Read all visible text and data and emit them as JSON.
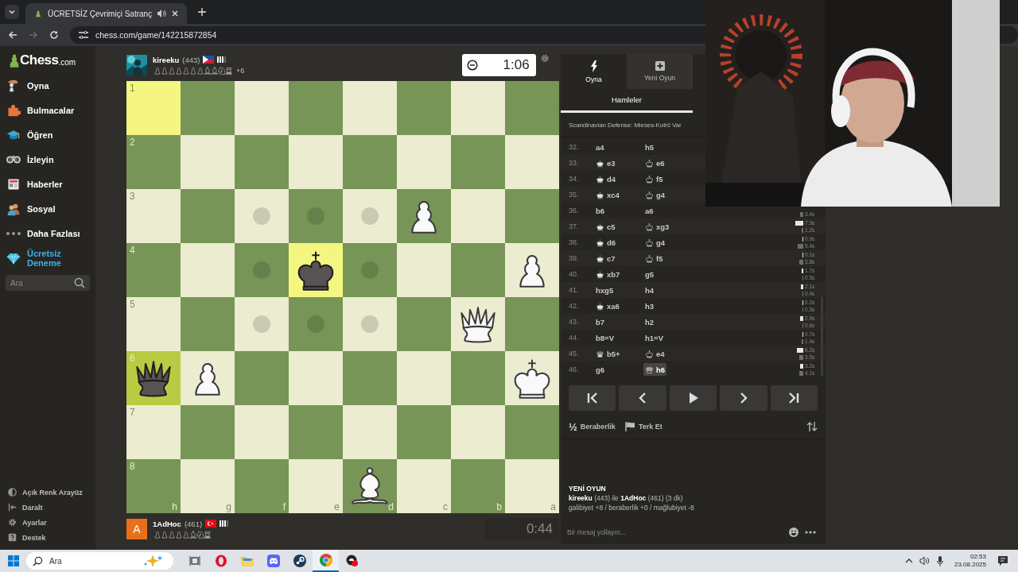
{
  "browser": {
    "tab_title": "ÜCRETSİZ Çevrimiçi Satranç",
    "url": "chess.com/game/142215872854"
  },
  "sidebar": {
    "logo_main": "Chess",
    "logo_suffix": ".com",
    "items": [
      {
        "label": "Oyna",
        "kind": "play"
      },
      {
        "label": "Bulmacalar",
        "kind": "puzzles"
      },
      {
        "label": "Öğren",
        "kind": "learn"
      },
      {
        "label": "İzleyin",
        "kind": "watch"
      },
      {
        "label": "Haberler",
        "kind": "news"
      },
      {
        "label": "Sosyal",
        "kind": "social"
      },
      {
        "label": "Daha Fazlası",
        "kind": "more"
      },
      {
        "label": "Ücretsiz Deneme",
        "kind": "premium"
      }
    ],
    "search_placeholder": "Ara",
    "footer_items": [
      {
        "label": "Açık Renk Arayüz",
        "kind": "theme"
      },
      {
        "label": "Daralt",
        "kind": "collapse"
      },
      {
        "label": "Ayarlar",
        "kind": "settings"
      },
      {
        "label": "Destek",
        "kind": "help"
      }
    ]
  },
  "top_player": {
    "name": "kireeku",
    "rating": "(443)",
    "advantage": "+6",
    "clock": "1:06",
    "clock_active": true
  },
  "bottom_player": {
    "name": "1AdHoc",
    "rating": "(461)",
    "avatar": {
      "kind": "letter",
      "letter": "A"
    },
    "clock": "0:44",
    "clock_active": false
  },
  "board": {
    "files": [
      "h",
      "g",
      "f",
      "e",
      "d",
      "c",
      "b",
      "a"
    ],
    "rows": [
      {
        "rank": "1",
        "squares": [
          {
            "highlighted": true,
            "move_dot": false
          },
          {
            "highlighted": false,
            "move_dot": false
          },
          {
            "highlighted": false,
            "move_dot": false
          },
          {
            "highlighted": false,
            "move_dot": false
          },
          {
            "highlighted": false,
            "move_dot": false
          },
          {
            "highlighted": false,
            "move_dot": false
          },
          {
            "highlighted": false,
            "move_dot": false
          },
          {
            "highlighted": false,
            "move_dot": false
          }
        ]
      },
      {
        "rank": "2",
        "squares": [
          {
            "highlighted": false,
            "move_dot": false
          },
          {
            "highlighted": false,
            "move_dot": false
          },
          {
            "highlighted": false,
            "move_dot": false
          },
          {
            "highlighted": false,
            "move_dot": false
          },
          {
            "highlighted": false,
            "move_dot": false
          },
          {
            "highlighted": false,
            "move_dot": false
          },
          {
            "highlighted": false,
            "move_dot": false
          },
          {
            "highlighted": false,
            "move_dot": false
          }
        ]
      },
      {
        "rank": "3",
        "squares": [
          {
            "highlighted": false,
            "move_dot": false
          },
          {
            "highlighted": false,
            "move_dot": false
          },
          {
            "highlighted": false,
            "move_dot": true
          },
          {
            "highlighted": false,
            "move_dot": true
          },
          {
            "highlighted": false,
            "move_dot": true
          },
          {
            "kind": "pawn",
            "white": true,
            "highlighted": false,
            "move_dot": false
          },
          {
            "highlighted": false,
            "move_dot": false
          },
          {
            "highlighted": false,
            "move_dot": false
          }
        ]
      },
      {
        "rank": "4",
        "squares": [
          {
            "highlighted": false,
            "move_dot": false
          },
          {
            "highlighted": false,
            "move_dot": false
          },
          {
            "highlighted": false,
            "move_dot": true
          },
          {
            "kind": "king",
            "white": false,
            "highlighted": true,
            "move_dot": false
          },
          {
            "highlighted": false,
            "move_dot": true
          },
          {
            "highlighted": false,
            "move_dot": false
          },
          {
            "highlighted": false,
            "move_dot": false
          },
          {
            "kind": "pawn",
            "white": true,
            "highlighted": false,
            "move_dot": false
          }
        ]
      },
      {
        "rank": "5",
        "squares": [
          {
            "highlighted": false,
            "move_dot": false
          },
          {
            "highlighted": false,
            "move_dot": false
          },
          {
            "highlighted": false,
            "move_dot": true
          },
          {
            "highlighted": false,
            "move_dot": true
          },
          {
            "highlighted": false,
            "move_dot": true
          },
          {
            "highlighted": false,
            "move_dot": false
          },
          {
            "kind": "queen",
            "white": true,
            "highlighted": false,
            "move_dot": false
          },
          {
            "highlighted": false,
            "move_dot": false
          }
        ]
      },
      {
        "rank": "6",
        "squares": [
          {
            "kind": "queen",
            "white": false,
            "highlighted": true,
            "move_dot": false
          },
          {
            "kind": "pawn",
            "white": true,
            "highlighted": false,
            "move_dot": false
          },
          {
            "highlighted": false,
            "move_dot": false
          },
          {
            "highlighted": false,
            "move_dot": false
          },
          {
            "highlighted": false,
            "move_dot": false
          },
          {
            "highlighted": false,
            "move_dot": false
          },
          {
            "highlighted": false,
            "move_dot": false
          },
          {
            "kind": "king",
            "white": true,
            "highlighted": false,
            "move_dot": false
          }
        ]
      },
      {
        "rank": "7",
        "squares": [
          {
            "highlighted": false,
            "move_dot": false
          },
          {
            "highlighted": false,
            "move_dot": false
          },
          {
            "highlighted": false,
            "move_dot": false
          },
          {
            "highlighted": false,
            "move_dot": false
          },
          {
            "highlighted": false,
            "move_dot": false
          },
          {
            "highlighted": false,
            "move_dot": false
          },
          {
            "highlighted": false,
            "move_dot": false
          },
          {
            "highlighted": false,
            "move_dot": false
          }
        ]
      },
      {
        "rank": "8",
        "squares": [
          {
            "highlighted": false,
            "move_dot": false
          },
          {
            "highlighted": false,
            "move_dot": false
          },
          {
            "highlighted": false,
            "move_dot": false
          },
          {
            "highlighted": false,
            "move_dot": false
          },
          {
            "kind": "bishop",
            "white": true,
            "highlighted": false,
            "move_dot": false
          },
          {
            "highlighted": false,
            "move_dot": false
          },
          {
            "highlighted": false,
            "move_dot": false
          },
          {
            "highlighted": false,
            "move_dot": false
          }
        ]
      }
    ]
  },
  "panel": {
    "tabs": [
      {
        "label": "Oyna",
        "kind": "play",
        "selected": true
      },
      {
        "label": "Yeni Oyun",
        "kind": "new",
        "selected": false
      }
    ],
    "subtabs": [
      {
        "label": "Hamleler",
        "selected": true
      }
    ],
    "opening": "Scandinavian Defense: Mieses-Kotrč Var",
    "moves": [
      {
        "number": "32.",
        "white": {
          "text": "a4",
          "selected": false
        },
        "black": {
          "text": "h5",
          "selected": false
        }
      },
      {
        "number": "33.",
        "white": {
          "kind": "king",
          "text": "e3",
          "selected": false
        },
        "black": {
          "kind": "king",
          "text": "e6",
          "selected": false
        }
      },
      {
        "number": "34.",
        "white": {
          "kind": "king",
          "text": "d4",
          "selected": false
        },
        "black": {
          "kind": "king",
          "text": "f5",
          "selected": false
        }
      },
      {
        "number": "35.",
        "white": {
          "kind": "king",
          "text": "xc4",
          "selected": false
        },
        "black": {
          "kind": "king",
          "text": "g4",
          "selected": false
        }
      },
      {
        "number": "36.",
        "white": {
          "text": "b6",
          "selected": false
        },
        "black": {
          "text": "a6",
          "selected": false,
          "time": "3.4s"
        }
      },
      {
        "number": "37.",
        "white": {
          "kind": "king",
          "text": "c5",
          "selected": false,
          "time": "7.9s"
        },
        "black": {
          "kind": "king",
          "text": "xg3",
          "selected": false,
          "time": "1.2s"
        }
      },
      {
        "number": "38.",
        "white": {
          "kind": "king",
          "text": "d6",
          "selected": false,
          "time": "0.9s"
        },
        "black": {
          "kind": "king",
          "text": "g4",
          "selected": false,
          "time": "5.4s"
        }
      },
      {
        "number": "39.",
        "white": {
          "kind": "king",
          "text": "c7",
          "selected": false,
          "time": "0.1s"
        },
        "black": {
          "kind": "king",
          "text": "f5",
          "selected": false,
          "time": "3.8s"
        }
      },
      {
        "number": "40.",
        "white": {
          "kind": "king",
          "text": "xb7",
          "selected": false,
          "time": "1.7s"
        },
        "black": {
          "text": "g5",
          "selected": false,
          "time": "0.5s"
        }
      },
      {
        "number": "41.",
        "white": {
          "text": "hxg5",
          "selected": false,
          "time": "2.1s"
        },
        "black": {
          "text": "h4",
          "selected": false,
          "time": "0.4s"
        }
      },
      {
        "number": "42.",
        "white": {
          "kind": "king",
          "text": "xa6",
          "selected": false,
          "time": "0.2s"
        },
        "black": {
          "text": "h3",
          "selected": false,
          "time": "0.3s"
        }
      },
      {
        "number": "43.",
        "white": {
          "text": "b7",
          "selected": false,
          "time": "2.9s"
        },
        "black": {
          "text": "h2",
          "selected": false,
          "time": "0.6s"
        }
      },
      {
        "number": "44.",
        "white": {
          "text": "b8=V",
          "selected": false,
          "time": "0.7s"
        },
        "black": {
          "text": "h1=V",
          "selected": false,
          "time": "1.4s"
        }
      },
      {
        "number": "45.",
        "white": {
          "kind": "queen",
          "text": "b5+",
          "selected": false,
          "time": "6.2s"
        },
        "black": {
          "kind": "king",
          "text": "e4",
          "selected": false,
          "time": "3.5s"
        }
      },
      {
        "number": "46.",
        "white": {
          "text": "g6",
          "selected": false,
          "time": "3.2s"
        },
        "black": {
          "kind": "queen",
          "text": "h6",
          "selected": true,
          "time": "4.1s"
        }
      }
    ],
    "controls": [
      {
        "kind": "first"
      },
      {
        "kind": "prev"
      },
      {
        "kind": "play"
      },
      {
        "kind": "next"
      },
      {
        "kind": "last"
      }
    ],
    "draw_icon": "½",
    "draw_label": "Beraberlik",
    "resign_label": "Terk Et"
  },
  "chat": {
    "title": "YENİ OYUN",
    "line1": "**kireeku** (443) ile **1AdHoc** (461) (3 dk)",
    "line2": "galibiyet +8 / beraberlik +0 / mağlubiyet -8",
    "placeholder": "Bir mesaj yollayın..."
  },
  "taskbar": {
    "search_placeholder": "Ara",
    "apps": [
      {
        "kind": "taskview",
        "selected": false
      },
      {
        "kind": "opera",
        "selected": false
      },
      {
        "kind": "files",
        "selected": false
      },
      {
        "kind": "discord",
        "selected": false
      },
      {
        "kind": "steam",
        "selected": false
      },
      {
        "kind": "chrome",
        "selected": true
      },
      {
        "kind": "app",
        "selected": false
      }
    ],
    "time": "02:53",
    "date": "23.08.2025"
  }
}
